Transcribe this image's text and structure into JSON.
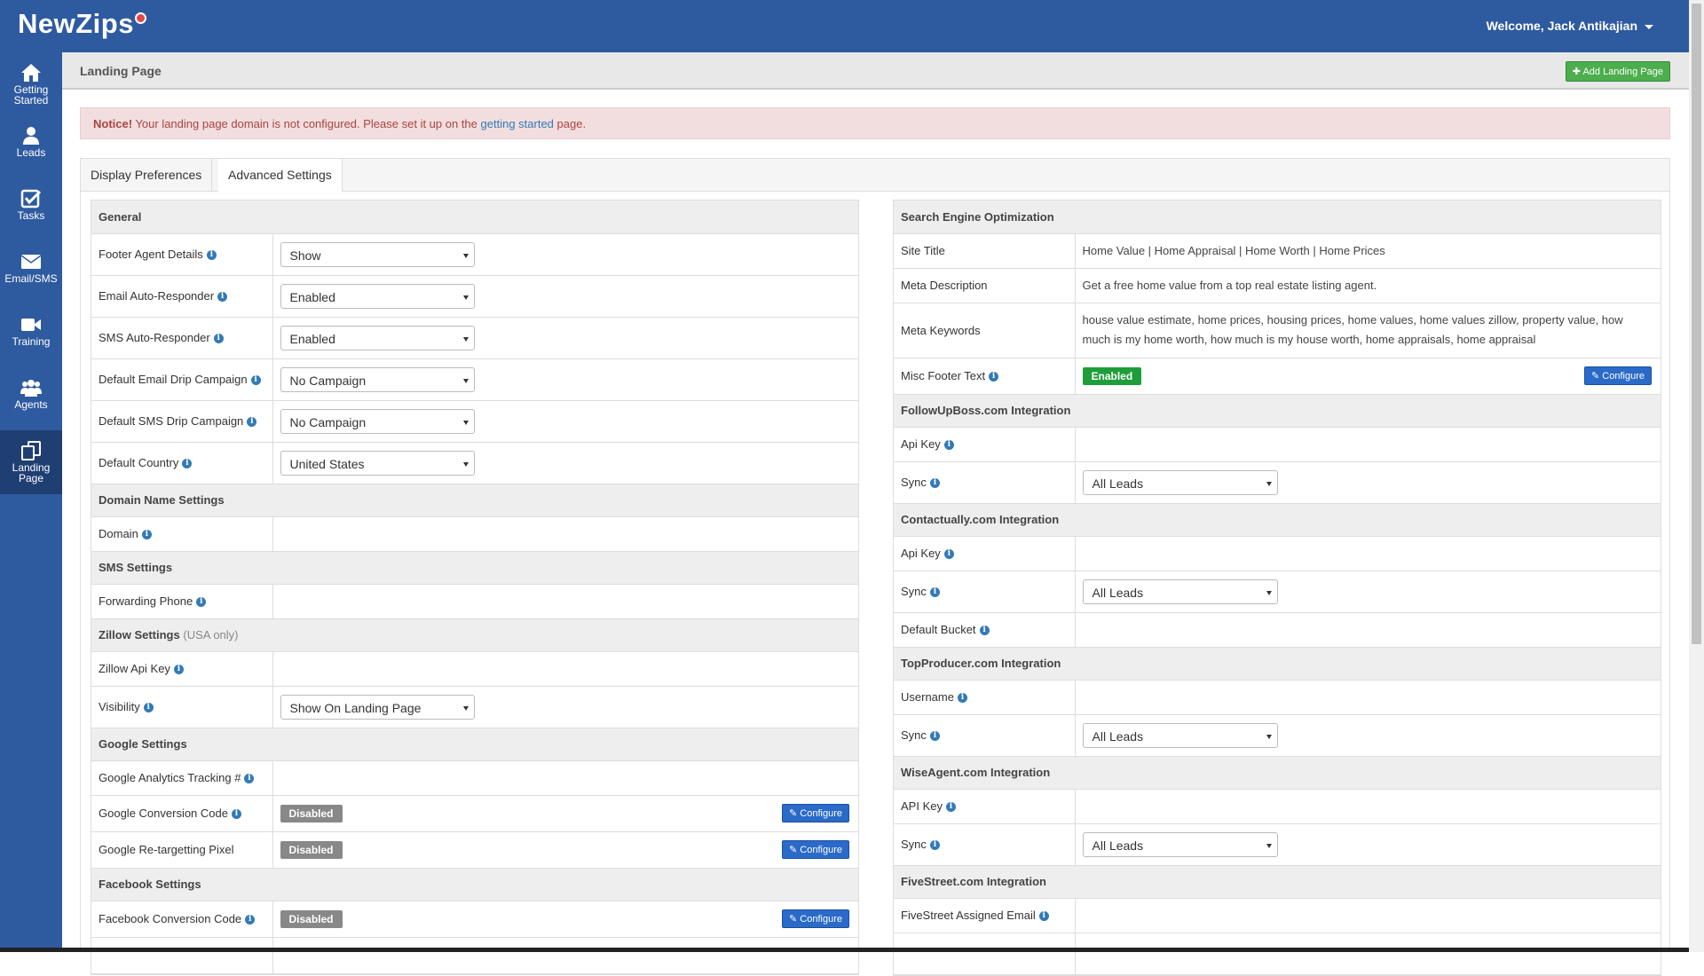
{
  "app": {
    "logo": "NewZips",
    "welcome": "Welcome, Jack Antikajian"
  },
  "sidebar": {
    "items": [
      {
        "label": "Getting Started",
        "icon": "home-icon"
      },
      {
        "label": "Leads",
        "icon": "user-icon"
      },
      {
        "label": "Tasks",
        "icon": "checkbox-icon"
      },
      {
        "label": "Email/SMS",
        "icon": "envelope-icon"
      },
      {
        "label": "Training",
        "icon": "video-camera-icon"
      },
      {
        "label": "Agents",
        "icon": "users-icon"
      },
      {
        "label": "Landing Page",
        "icon": "copy-pages-icon",
        "active": true
      }
    ]
  },
  "header": {
    "title": "Landing Page",
    "add_button": "Add Landing Page"
  },
  "notice": {
    "strong": "Notice!",
    "text": " Your landing page domain is not configured. Please set it up on the ",
    "link": "getting started",
    "after": " page."
  },
  "tabs": [
    {
      "label": "Display Preferences"
    },
    {
      "label": "Advanced Settings",
      "active": true
    }
  ],
  "left": {
    "general": {
      "title": "General",
      "footer_agent": {
        "label": "Footer Agent Details",
        "value": "Show"
      },
      "email_auto": {
        "label": "Email Auto-Responder",
        "value": "Enabled"
      },
      "sms_auto": {
        "label": "SMS Auto-Responder",
        "value": "Enabled"
      },
      "email_drip": {
        "label": "Default Email Drip Campaign",
        "value": "No Campaign"
      },
      "sms_drip": {
        "label": "Default SMS Drip Campaign",
        "value": "No Campaign"
      },
      "country": {
        "label": "Default Country",
        "value": "United States"
      }
    },
    "domain": {
      "title": "Domain Name Settings",
      "domain": {
        "label": "Domain",
        "value": ""
      }
    },
    "sms": {
      "title": "SMS Settings",
      "forwarding": {
        "label": "Forwarding Phone",
        "value": ""
      }
    },
    "zillow": {
      "title": "Zillow Settings",
      "note": "(USA only)",
      "api_key": {
        "label": "Zillow Api Key",
        "value": ""
      },
      "visibility": {
        "label": "Visibility",
        "value": "Show On Landing Page"
      }
    },
    "google": {
      "title": "Google Settings",
      "analytics": {
        "label": "Google Analytics Tracking #",
        "value": ""
      },
      "conversion": {
        "label": "Google Conversion Code",
        "status": "Disabled",
        "button": "Configure"
      },
      "retargeting": {
        "label": "Google Re-targetting Pixel",
        "status": "Disabled",
        "button": "Configure"
      }
    },
    "facebook": {
      "title": "Facebook Settings",
      "conversion": {
        "label": "Facebook Conversion Code",
        "status": "Disabled",
        "button": "Configure"
      }
    }
  },
  "right": {
    "seo": {
      "title": "Search Engine Optimization",
      "site_title": {
        "label": "Site Title",
        "value": "Home Value | Home Appraisal | Home Worth | Home Prices"
      },
      "meta_desc": {
        "label": "Meta Description",
        "value": "Get a free home value from a top real estate listing agent."
      },
      "meta_keywords": {
        "label": "Meta Keywords",
        "value": "house value estimate, home prices, housing prices, home values, home values zillow, property value, how much is my home worth, how much is my house worth, home appraisals, home appraisal"
      },
      "misc_footer": {
        "label": "Misc Footer Text",
        "status": "Enabled",
        "button": "Configure"
      }
    },
    "followupboss": {
      "title": "FollowUpBoss.com Integration",
      "api_key": {
        "label": "Api Key",
        "value": ""
      },
      "sync": {
        "label": "Sync",
        "value": "All Leads"
      }
    },
    "contactually": {
      "title": "Contactually.com Integration",
      "api_key": {
        "label": "Api Key",
        "value": ""
      },
      "sync": {
        "label": "Sync",
        "value": "All Leads"
      },
      "bucket": {
        "label": "Default Bucket",
        "value": ""
      }
    },
    "topproducer": {
      "title": "TopProducer.com Integration",
      "username": {
        "label": "Username",
        "value": ""
      },
      "sync": {
        "label": "Sync",
        "value": "All Leads"
      }
    },
    "wiseagent": {
      "title": "WiseAgent.com Integration",
      "api_key": {
        "label": "API Key",
        "value": ""
      },
      "sync": {
        "label": "Sync",
        "value": "All Leads"
      }
    },
    "fivestreet": {
      "title": "FiveStreet.com Integration",
      "email": {
        "label": "FiveStreet Assigned Email",
        "value": ""
      }
    }
  },
  "colors": {
    "brand": "#2e5aa0",
    "sidebar_active": "#1f3f73",
    "success": "#1e9e3a",
    "primary": "#2a6ac8",
    "notice_bg": "#f2dede"
  }
}
